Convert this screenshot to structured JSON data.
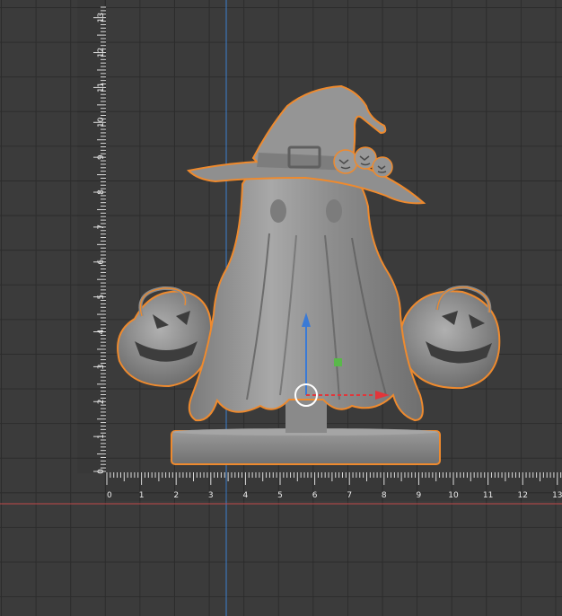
{
  "viewport": {
    "name": "3D model viewport",
    "background": "#3b3b3b",
    "grid_color": "#2c2c2c",
    "axis_x_color": "#c2484a",
    "axis_y_color": "#3b7fcf"
  },
  "model": {
    "description_icon": "witch-ghost-figurine",
    "color": "#8d8d8d",
    "selection_outline_color": "#ee8a2e"
  },
  "gizmo": {
    "x_axis_color": "#e2353a",
    "y_axis_color": "#3a7ad6",
    "z_handle_color": "#5ab84a",
    "center_ring_color": "#ffffff"
  },
  "ruler_vertical": {
    "labels": [
      "0",
      "1",
      "2",
      "3",
      "4",
      "5",
      "6",
      "7",
      "8",
      "9",
      "10",
      "11",
      "12",
      "13"
    ]
  },
  "ruler_horizontal": {
    "labels": [
      "0",
      "1",
      "2",
      "3",
      "4",
      "5",
      "6",
      "7",
      "8",
      "9",
      "10",
      "11",
      "12",
      "13"
    ]
  }
}
